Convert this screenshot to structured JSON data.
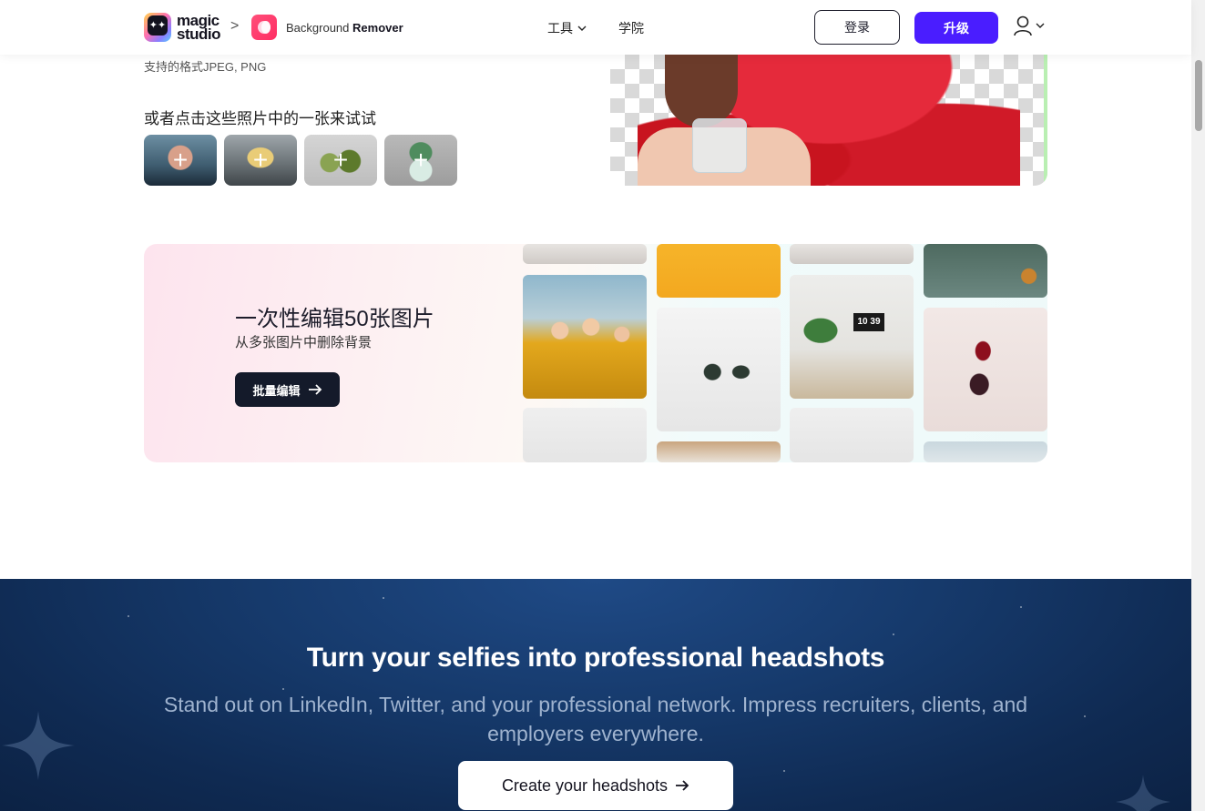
{
  "header": {
    "logo_line1": "magic",
    "logo_line2": "studio",
    "logo_icon": "sparkle-logo-icon",
    "breadcrumb_separator": ">",
    "tool_icon": "background-remover-icon",
    "tool_name_part1": "Background",
    "tool_name_part2": "Remover",
    "nav": {
      "tools": "工具",
      "academy": "学院"
    },
    "login": "登录",
    "upgrade": "升级",
    "upgrade_color": "#4a1dff",
    "user_icon": "user-icon"
  },
  "upload": {
    "formats_text": "支持的格式JPEG, PNG",
    "try_label": "或者点击这些照片中的一张来试试",
    "samples": [
      {
        "name": "woman-portrait",
        "icon": "plus-icon"
      },
      {
        "name": "dog",
        "icon": "plus-icon"
      },
      {
        "name": "avocado",
        "icon": "plus-icon"
      },
      {
        "name": "succulent-plant",
        "icon": "plus-icon"
      }
    ],
    "plus_glyph": "+"
  },
  "batch": {
    "title": "一次性编辑50张图片",
    "subtitle": "从多张图片中删除背景",
    "button": "批量编辑",
    "button_icon": "arrow-right-icon",
    "clock_text": "10 39"
  },
  "headshots": {
    "title": "Turn your selfies into professional headshots",
    "subtitle": "Stand out on LinkedIn, Twitter, and your professional network. Impress recruiters, clients, and employers everywhere.",
    "button": "Create your headshots",
    "button_icon": "arrow-right-icon",
    "background_color": "#163a6c"
  }
}
